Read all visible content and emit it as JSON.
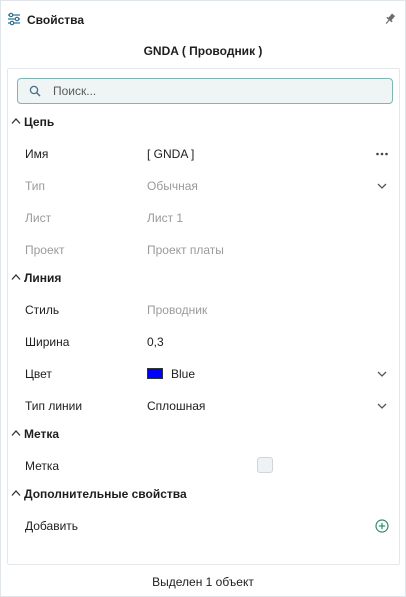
{
  "header": {
    "title": "Свойства",
    "settings_icon": "sliders-icon",
    "pin_icon": "pin-icon"
  },
  "object_title": "GNDA ( Проводник )",
  "search": {
    "placeholder": "Поиск...",
    "value": ""
  },
  "sections": {
    "net": {
      "title": "Цепь",
      "rows": {
        "name": {
          "label": "Имя",
          "value": "[ GNDA ]"
        },
        "type": {
          "label": "Тип",
          "value": "Обычная"
        },
        "sheet": {
          "label": "Лист",
          "value": "Лист 1"
        },
        "project": {
          "label": "Проект",
          "value": "Проект платы"
        }
      }
    },
    "line": {
      "title": "Линия",
      "rows": {
        "style": {
          "label": "Стиль",
          "value": "Проводник"
        },
        "width": {
          "label": "Ширина",
          "value": "0,3"
        },
        "color": {
          "label": "Цвет",
          "value": "Blue",
          "swatch": "#0000ff"
        },
        "line_type": {
          "label": "Тип линии",
          "value": "Сплошная"
        }
      }
    },
    "mark": {
      "title": "Метка",
      "rows": {
        "mark": {
          "label": "Метка",
          "checked": false
        }
      }
    },
    "extra": {
      "title": "Дополнительные свойства",
      "rows": {
        "add": {
          "label": "Добавить"
        }
      }
    }
  },
  "footer": {
    "status": "Выделен 1 объект"
  },
  "colors": {
    "accent": "#2e8b6e",
    "search_border": "#7fb5b2",
    "search_bg": "#eef5f4",
    "disabled_text": "#9a9a9a"
  }
}
